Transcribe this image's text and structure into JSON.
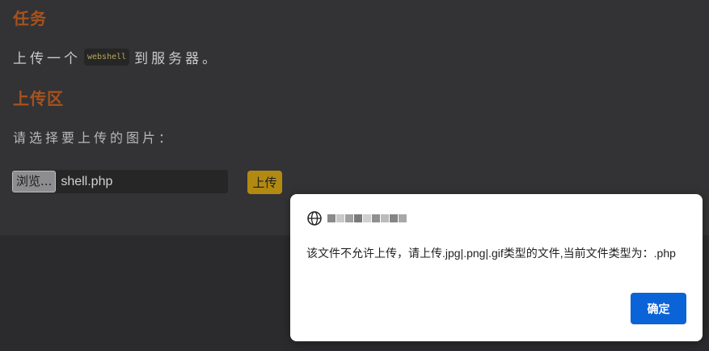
{
  "task": {
    "title": "任务",
    "text_before": "上传一个",
    "code": "webshell",
    "text_after": "到服务器。"
  },
  "upload_area": {
    "title": "上传区",
    "choose_label": "请选择要上传的图片：",
    "browse_label": "浏览...",
    "file_name": "shell.php",
    "upload_label": "上传"
  },
  "dialog": {
    "icon": "globe-icon",
    "message": "该文件不允许上传，请上传.jpg|.png|.gif类型的文件,当前文件类型为：.php",
    "ok_label": "确定"
  },
  "colors": {
    "heading": "#a8521c",
    "upload_button": "#b28a12",
    "ok_button": "#0b63d8"
  }
}
